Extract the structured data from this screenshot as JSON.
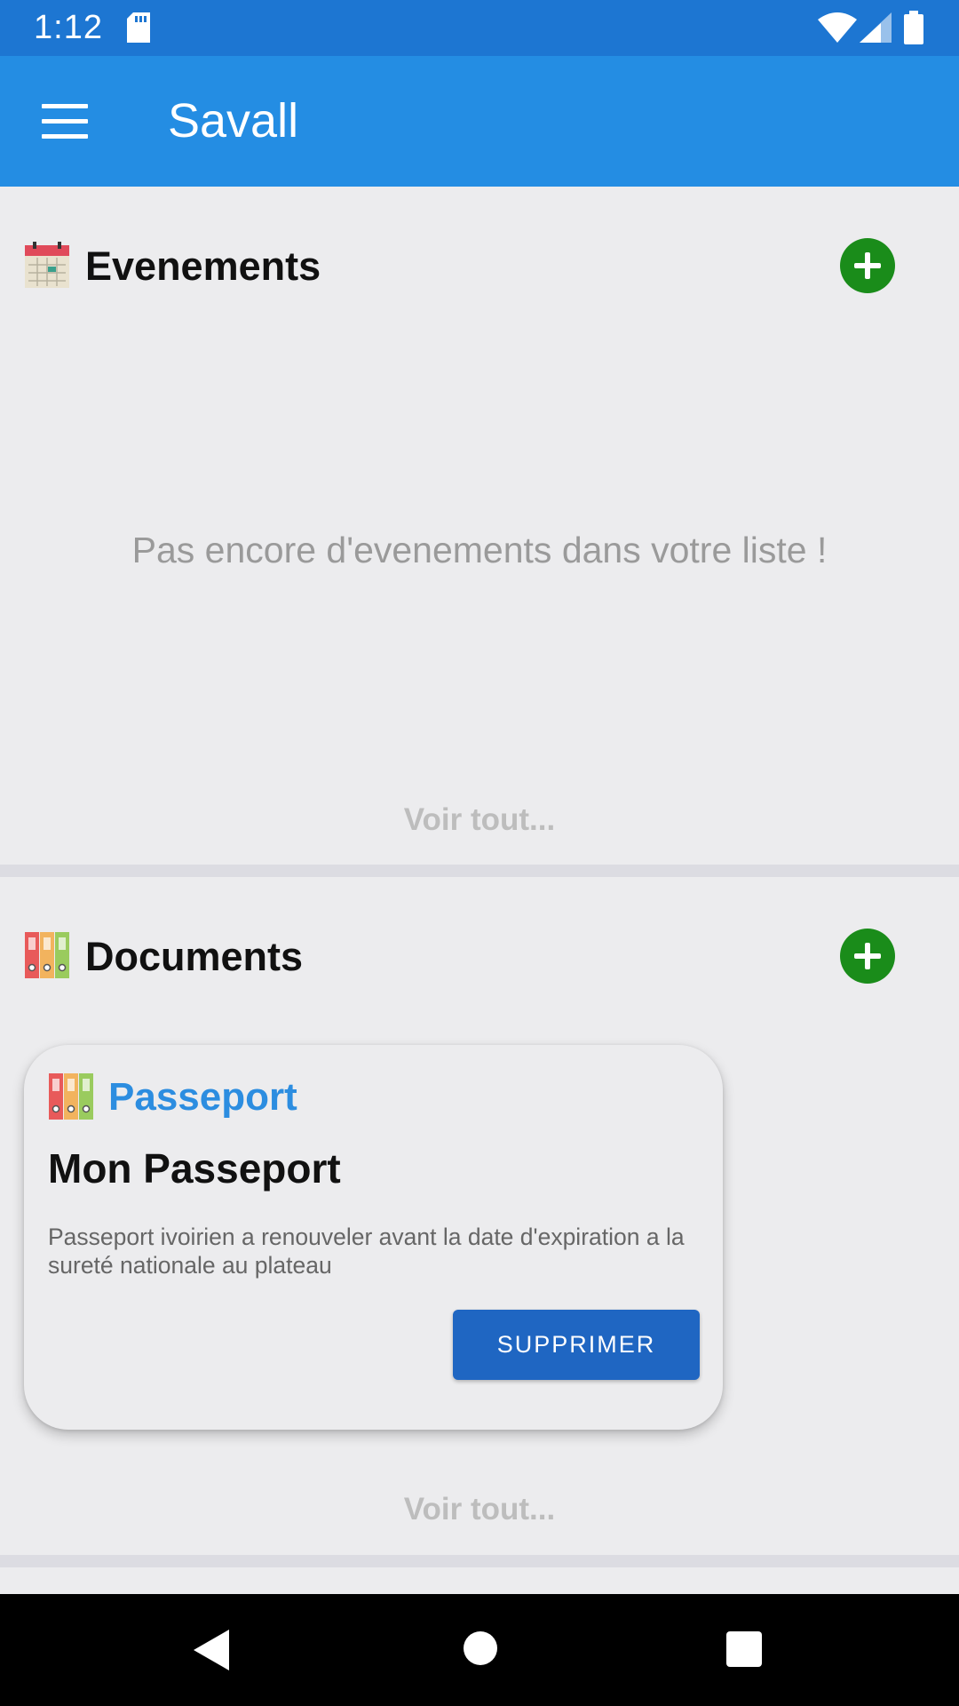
{
  "status_bar": {
    "time": "1:12",
    "icons": [
      "sd-card-icon",
      "wifi-icon",
      "signal-icon",
      "battery-icon"
    ]
  },
  "app_bar": {
    "title": "Savall",
    "menu_icon": "menu-icon"
  },
  "events_section": {
    "title": "Evenements",
    "icon": "calendar-icon",
    "add_icon": "add-circle-icon",
    "empty_message": "Pas encore d'evenements dans votre liste !",
    "see_all_label": "Voir tout..."
  },
  "documents_section": {
    "title": "Documents",
    "icon": "binders-icon",
    "add_icon": "add-circle-icon",
    "see_all_label": "Voir tout...",
    "cards": [
      {
        "category": "Passeport",
        "title": "Mon Passeport",
        "description": "Passeport ivoirien a renouveler avant la date d'expiration a la sureté nationale au plateau",
        "delete_label": "SUPPRIMER"
      }
    ]
  },
  "nav_bar": {
    "icons": [
      "back-icon",
      "home-icon",
      "recents-icon"
    ]
  },
  "colors": {
    "status_bar": "#1d76d2",
    "app_bar": "#248de3",
    "add_button": "#1a8c1a",
    "delete_button": "#1f66c2",
    "category_text": "#2c8de0",
    "background": "#ececee"
  }
}
